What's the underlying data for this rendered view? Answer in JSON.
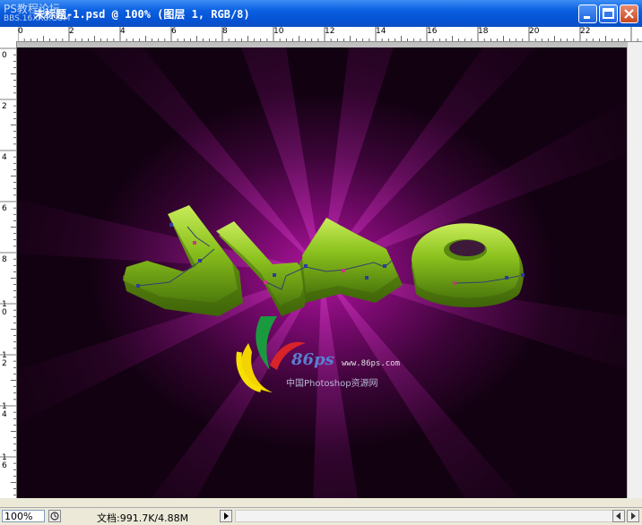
{
  "window": {
    "title": "未标题-1.psd @ 100% (图层 1, RGB/8)",
    "title_watermark": "PS教程论坛",
    "title_watermark_sub": "BBS.16XX8.COM"
  },
  "ruler": {
    "top_labels": [
      "0",
      "2",
      "4",
      "6",
      "8",
      "10",
      "12",
      "14",
      "16",
      "18",
      "20",
      "22"
    ],
    "left_labels": [
      "0",
      "2",
      "4",
      "6",
      "8",
      "1 0",
      "1 2",
      "1 4",
      "1 6"
    ]
  },
  "canvas": {
    "artwork": "JNG",
    "logo_text": "86ps",
    "logo_url": "www.86ps.com",
    "logo_tagline": "中国Photoshop资源网",
    "colors": {
      "glow": "#b0169f",
      "letters": "#8cc21e",
      "background": "#120111"
    }
  },
  "status": {
    "zoom": "100%",
    "doc_info": "文档:991.7K/4.88M"
  }
}
